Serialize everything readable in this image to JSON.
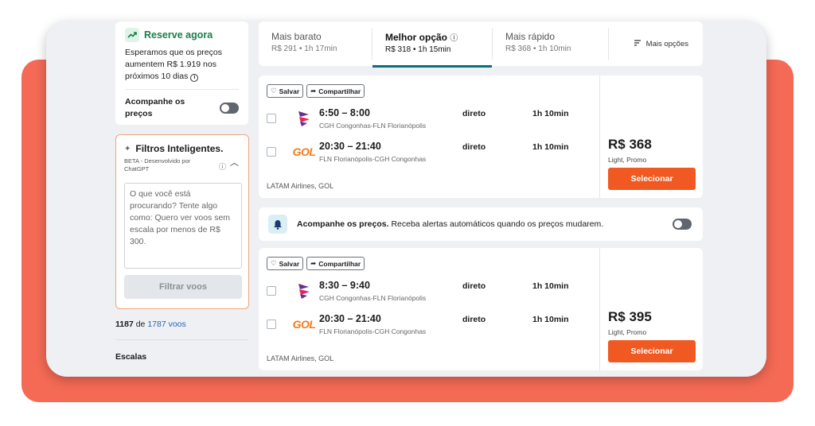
{
  "reserve": {
    "title": "Reserve agora",
    "text": "Esperamos que os preços aumentem R$ 1.919 nos próximos 10 dias",
    "track_label": "Acompanhe os preços"
  },
  "filters": {
    "title": "Filtros Inteligentes.",
    "subtitle": "BETA - Desenvolvido por ChatGPT",
    "placeholder": "O que você está procurando? Tente algo como: Quero ver voos sem escala por menos de R$ 300.",
    "button": "Filtrar voos"
  },
  "results": {
    "shown": "1187",
    "connector": "de",
    "total": "1787 voos"
  },
  "escalas": "Escalas",
  "tabs": [
    {
      "label": "Mais barato",
      "sub": "R$ 291 • 1h 17min"
    },
    {
      "label": "Melhor opção",
      "sub": "R$ 318 • 1h 15min"
    },
    {
      "label": "Mais rápido",
      "sub": "R$ 368 • 1h 10min"
    }
  ],
  "more_options": "Mais opções",
  "actions": {
    "save": "Salvar",
    "share": "Compartilhar"
  },
  "alert": {
    "bold": "Acompanhe os preços.",
    "text": "Receba alertas automáticos quando os preços mudarem."
  },
  "flights": [
    {
      "legs": [
        {
          "airline_logo": "LATAM",
          "times": "6:50 – 8:00",
          "route": "CGH Congonhas-FLN Florianópolis",
          "stops": "direto",
          "duration": "1h 10min"
        },
        {
          "airline_logo": "GOL",
          "times": "20:30 – 21:40",
          "route": "FLN Florianópolis-CGH Congonhas",
          "stops": "direto",
          "duration": "1h 10min"
        }
      ],
      "airlines": "LATAM Airlines, GOL",
      "price": "R$ 368",
      "fare": "Light, Promo",
      "select": "Selecionar"
    },
    {
      "legs": [
        {
          "airline_logo": "LATAM",
          "times": "8:30 – 9:40",
          "route": "CGH Congonhas-FLN Florianópolis",
          "stops": "direto",
          "duration": "1h 10min"
        },
        {
          "airline_logo": "GOL",
          "times": "20:30 – 21:40",
          "route": "FLN Florianópolis-CGH Congonhas",
          "stops": "direto",
          "duration": "1h 10min"
        }
      ],
      "airlines": "LATAM Airlines, GOL",
      "price": "R$ 395",
      "fare": "Light, Promo",
      "select": "Selecionar"
    }
  ],
  "colors": {
    "accent": "#f05a22",
    "tab_underline": "#0a6f7a",
    "green": "#1a7f46",
    "backdrop": "#f46a55"
  }
}
